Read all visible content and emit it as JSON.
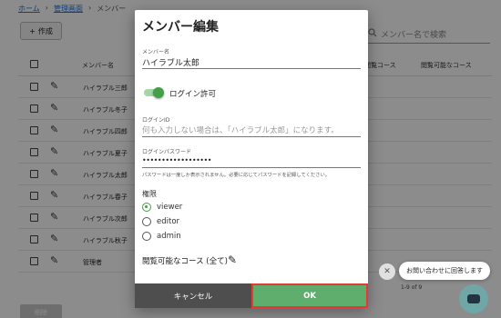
{
  "breadcrumb": {
    "home": "ホーム",
    "admin": "管理画面",
    "current": "メンバー"
  },
  "toolbar": {
    "create_label": "作成",
    "search_placeholder": "メンバー名で検索"
  },
  "table": {
    "headers": {
      "name": "メンバー名",
      "col1": "閲覧コース",
      "col2": "閲覧可能なコース"
    },
    "rows": [
      "ハイラブル三郎",
      "ハイラブル冬子",
      "ハイラブル四郎",
      "ハイラブル夏子",
      "ハイラブル太郎",
      "ハイラブル春子",
      "ハイラブル次郎",
      "ハイラブル秋子",
      "管理者"
    ]
  },
  "pagination": {
    "range": "1-9 of 9"
  },
  "bulk": {
    "delete_label": "削除"
  },
  "dialog": {
    "title": "メンバー編集",
    "member_name_label": "メンバー名",
    "member_name_value": "ハイラブル太郎",
    "login_toggle_label": "ログイン許可",
    "login_id_label": "ログインID",
    "login_id_placeholder": "何も入力しない場合は、「ハイラブル太郎」になります。",
    "password_label": "ログインパスワード",
    "password_value": "••••••••••••••••••",
    "password_hint": "パスワードは一度しか表示されません。必要に応じてパスワードを記録してください。",
    "permission_label": "権限",
    "roles": [
      "viewer",
      "editor",
      "admin"
    ],
    "selected_role": "viewer",
    "course_label": "閲覧可能なコース (全て)",
    "cancel_label": "キャンセル",
    "ok_label": "OK"
  },
  "chat": {
    "close": "✕",
    "prompt": "お問い合わせに回答します"
  },
  "colors": {
    "accent_green": "#43a047",
    "ok_button": "#5fae6e",
    "cancel_button": "#4e4e4e",
    "highlight": "#e53935"
  }
}
